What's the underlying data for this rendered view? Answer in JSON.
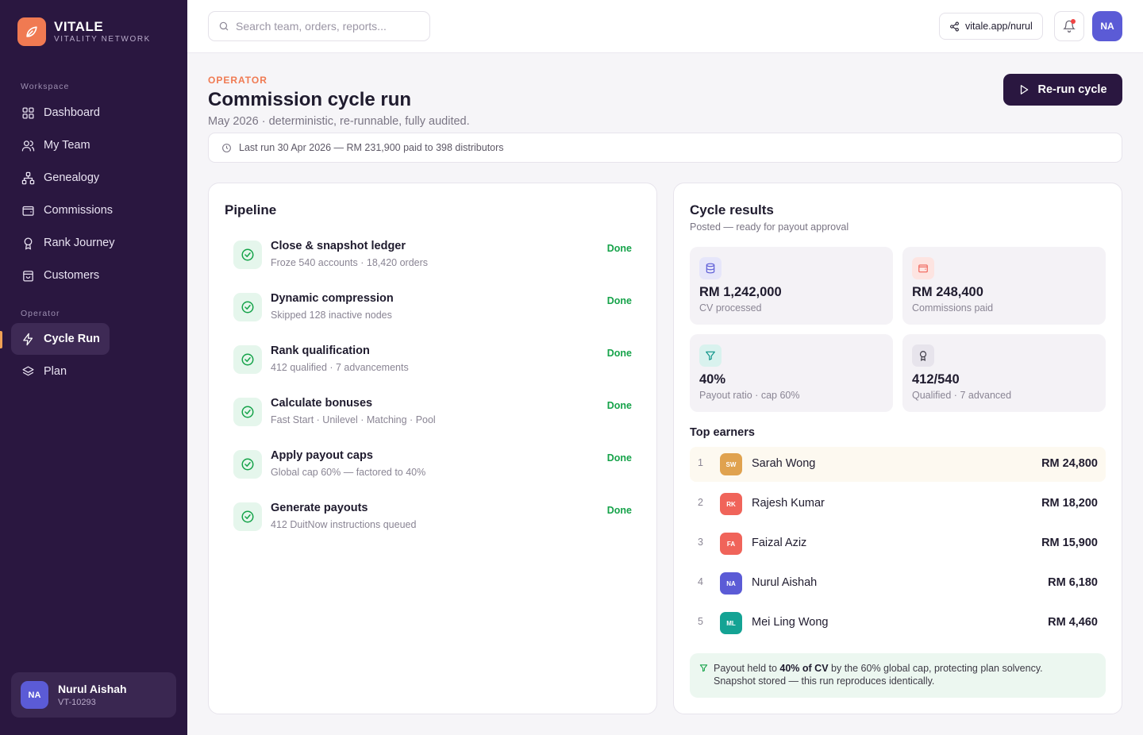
{
  "brand": {
    "name": "VITALE",
    "subtitle": "VITALITY NETWORK"
  },
  "sidebar": {
    "workspace_label": "Workspace",
    "operator_label": "Operator",
    "workspace_items": [
      {
        "label": "Dashboard",
        "icon": "grid-icon"
      },
      {
        "label": "My Team",
        "icon": "users-icon"
      },
      {
        "label": "Genealogy",
        "icon": "hierarchy-icon"
      },
      {
        "label": "Commissions",
        "icon": "wallet-icon"
      },
      {
        "label": "Rank Journey",
        "icon": "award-icon"
      },
      {
        "label": "Customers",
        "icon": "bag-icon"
      }
    ],
    "operator_items": [
      {
        "label": "Cycle Run",
        "icon": "lightning-icon",
        "active": true
      },
      {
        "label": "Plan",
        "icon": "layers-icon"
      }
    ],
    "user": {
      "initials": "NA",
      "name": "Nurul Aishah",
      "id": "VT-10293"
    }
  },
  "topbar": {
    "search_placeholder": "Search team, orders, reports...",
    "share_link": "vitale.app/nurul",
    "avatar_initials": "NA"
  },
  "header": {
    "eyebrow": "OPERATOR",
    "title": "Commission cycle run",
    "subtitle": "May 2026 · deterministic, re-runnable, fully audited.",
    "rerun_label": "Re-run cycle",
    "last_run": "Last run 30 Apr 2026 — RM 231,900 paid to 398 distributors"
  },
  "pipeline": {
    "title": "Pipeline",
    "steps": [
      {
        "title": "Close & snapshot ledger",
        "sub": "Froze 540 accounts · 18,420 orders",
        "status": "Done"
      },
      {
        "title": "Dynamic compression",
        "sub": "Skipped 128 inactive nodes",
        "status": "Done"
      },
      {
        "title": "Rank qualification",
        "sub": "412 qualified · 7 advancements",
        "status": "Done"
      },
      {
        "title": "Calculate bonuses",
        "sub": "Fast Start · Unilevel · Matching · Pool",
        "status": "Done"
      },
      {
        "title": "Apply payout caps",
        "sub": "Global cap 60% — factored to 40%",
        "status": "Done"
      },
      {
        "title": "Generate payouts",
        "sub": "412 DuitNow instructions queued",
        "status": "Done"
      }
    ]
  },
  "results": {
    "title": "Cycle results",
    "subtitle": "Posted — ready for payout approval",
    "stats": [
      {
        "value": "RM 1,242,000",
        "label": "CV processed",
        "icon": "database-icon",
        "color": "#5b5bd6",
        "bg": "#e6e6fa"
      },
      {
        "value": "RM 248,400",
        "label": "Commissions paid",
        "icon": "wallet-icon",
        "color": "#f0645a",
        "bg": "#fde4e1"
      },
      {
        "value": "40%",
        "label": "Payout ratio · cap 60%",
        "icon": "filter-icon",
        "color": "#0d9488",
        "bg": "#d9f2ee"
      },
      {
        "value": "412/540",
        "label": "Qualified · 7 advanced",
        "icon": "award-icon",
        "color": "#3d3a45",
        "bg": "#e7e4ec"
      }
    ],
    "top_earners_label": "Top earners",
    "earners": [
      {
        "rank": "1",
        "initials": "SW",
        "name": "Sarah Wong",
        "amount": "RM 24,800",
        "color": "#e0a24f"
      },
      {
        "rank": "2",
        "initials": "RK",
        "name": "Rajesh Kumar",
        "amount": "RM 18,200",
        "color": "#f0645a"
      },
      {
        "rank": "3",
        "initials": "FA",
        "name": "Faizal Aziz",
        "amount": "RM 15,900",
        "color": "#f0645a"
      },
      {
        "rank": "4",
        "initials": "NA",
        "name": "Nurul Aishah",
        "amount": "RM 6,180",
        "color": "#5b5bd6"
      },
      {
        "rank": "5",
        "initials": "ML",
        "name": "Mei Ling Wong",
        "amount": "RM 4,460",
        "color": "#14a394"
      }
    ],
    "note": {
      "pre": "Payout held to ",
      "bold": "40% of CV",
      "post": " by the 60% global cap, protecting plan solvency.",
      "line2": "Snapshot stored — this run reproduces identically."
    }
  }
}
